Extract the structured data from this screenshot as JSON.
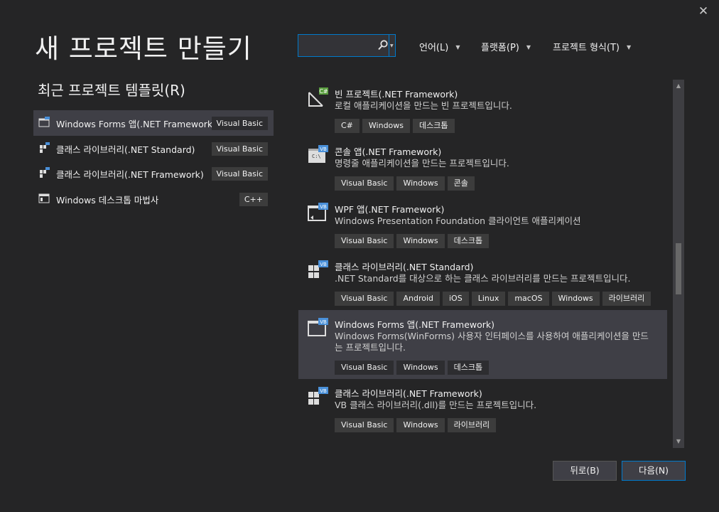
{
  "window": {
    "title": "새 프로젝트 만들기"
  },
  "search": {
    "value": "",
    "placeholder": ""
  },
  "filters": [
    {
      "label": "언어(L)"
    },
    {
      "label": "플랫폼(P)"
    },
    {
      "label": "프로젝트 형식(T)"
    }
  ],
  "recent": {
    "heading": "최근 프로젝트 템플릿(R)",
    "items": [
      {
        "name": "Windows Forms 앱(.NET Framework)",
        "lang": "Visual Basic"
      },
      {
        "name": "클래스 라이브러리(.NET Standard)",
        "lang": "Visual Basic"
      },
      {
        "name": "클래스 라이브러리(.NET Framework)",
        "lang": "Visual Basic"
      },
      {
        "name": "Windows 데스크톱 마법사",
        "lang": "C++"
      }
    ]
  },
  "templates": [
    {
      "name": "빈 프로젝트(.NET Framework)",
      "desc": "로컬 애플리케이션을 만드는 빈 프로젝트입니다.",
      "tags": [
        "C#",
        "Windows",
        "데스크톱"
      ],
      "badge": "C#"
    },
    {
      "name": "콘솔 앱(.NET Framework)",
      "desc": "명령줄 애플리케이션을 만드는 프로젝트입니다.",
      "tags": [
        "Visual Basic",
        "Windows",
        "콘솔"
      ],
      "badge": "VB"
    },
    {
      "name": "WPF 앱(.NET Framework)",
      "desc": "Windows Presentation Foundation 클라이언트 애플리케이션",
      "tags": [
        "Visual Basic",
        "Windows",
        "데스크톱"
      ],
      "badge": "VB"
    },
    {
      "name": "클래스 라이브러리(.NET Standard)",
      "desc": ".NET Standard를 대상으로 하는 클래스 라이브러리를 만드는 프로젝트입니다.",
      "tags": [
        "Visual Basic",
        "Android",
        "iOS",
        "Linux",
        "macOS",
        "Windows",
        "라이브러리"
      ],
      "badge": "VB"
    },
    {
      "name": "Windows Forms 앱(.NET Framework)",
      "desc": "Windows Forms(WinForms) 사용자 인터페이스를 사용하여 애플리케이션을 만드는 프로젝트입니다.",
      "tags": [
        "Visual Basic",
        "Windows",
        "데스크톱"
      ],
      "badge": "VB"
    },
    {
      "name": "클래스 라이브러리(.NET Framework)",
      "desc": "VB 클래스 라이브러리(.dll)를 만드는 프로젝트입니다.",
      "tags": [
        "Visual Basic",
        "Windows",
        "라이브러리"
      ],
      "badge": "VB"
    }
  ],
  "buttons": {
    "back": "뒤로(B)",
    "next": "다음(N)"
  },
  "colors": {
    "background": "#252526",
    "selected": "#3f3f46",
    "accent": "#007acc",
    "badge_csharp": "#5a9e3f",
    "badge_vb": "#4a90d9"
  }
}
